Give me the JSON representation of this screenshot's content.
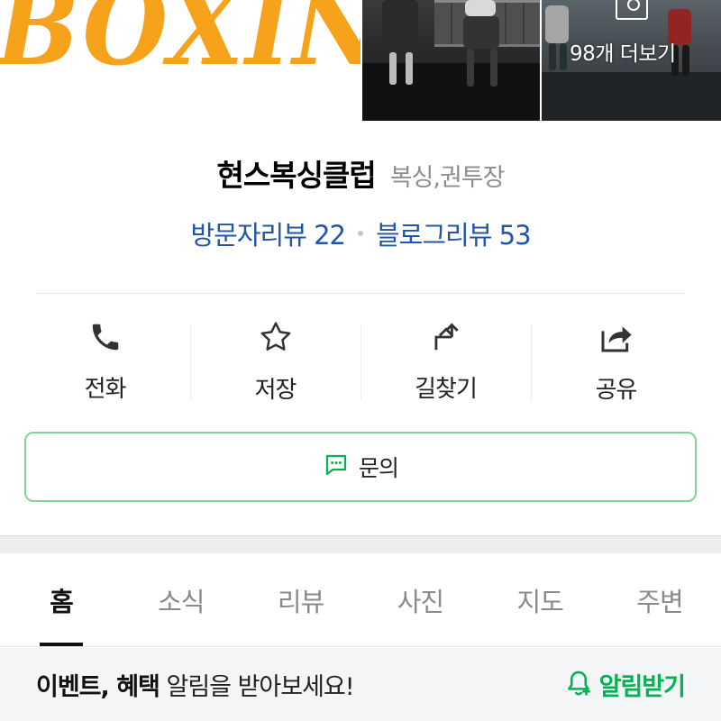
{
  "photos": {
    "logo_text": "BOXING",
    "more_label": "98개 더보기"
  },
  "place": {
    "name": "현스복싱클럽",
    "category": "복싱,권투장",
    "visitor_reviews": "방문자리뷰 22",
    "blog_reviews": "블로그리뷰 53"
  },
  "actions": [
    {
      "label": "전화",
      "icon": "phone-icon"
    },
    {
      "label": "저장",
      "icon": "star-icon"
    },
    {
      "label": "길찾기",
      "icon": "directions-icon"
    },
    {
      "label": "공유",
      "icon": "share-icon"
    }
  ],
  "inquiry": {
    "label": "문의",
    "icon": "chat-icon"
  },
  "tabs": [
    {
      "label": "홈",
      "active": true
    },
    {
      "label": "소식",
      "active": false
    },
    {
      "label": "리뷰",
      "active": false
    },
    {
      "label": "사진",
      "active": false
    },
    {
      "label": "지도",
      "active": false
    },
    {
      "label": "주변",
      "active": false
    }
  ],
  "banner": {
    "bold_part1": "이벤트",
    "separator": ", ",
    "bold_part2": "혜택",
    "rest": " 알림을 받아보세요!",
    "subscribe_label": "알림받기"
  },
  "colors": {
    "link_blue": "#2155a8",
    "accent_green": "#03b253",
    "border_green": "#7ed49a",
    "logo_orange": "#f6a21a"
  }
}
